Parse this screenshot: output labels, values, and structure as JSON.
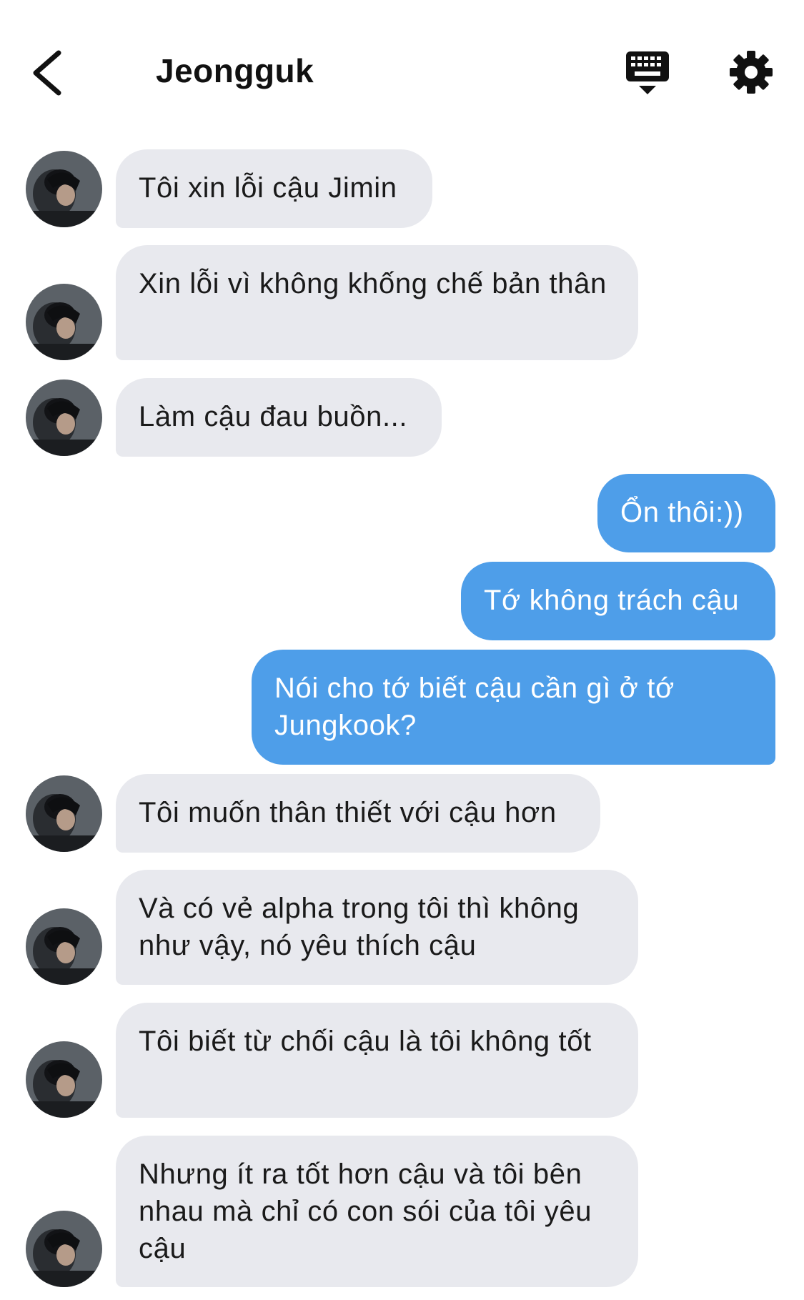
{
  "header": {
    "title": "Jeongguk",
    "icons": {
      "back": "chevron-left-icon",
      "keyboard": "keyboard-icon",
      "settings": "gear-icon"
    }
  },
  "colors": {
    "incoming_bubble": "#e8e9ee",
    "outgoing_bubble": "#4e9ee9",
    "outgoing_text": "#ffffff",
    "incoming_text": "#1a1a1a"
  },
  "messages": [
    {
      "sender": "Jeongguk",
      "direction": "incoming",
      "text": "Tôi xin lỗi cậu Jimin"
    },
    {
      "sender": "Jeongguk",
      "direction": "incoming",
      "text": "Xin lỗi vì không khống chế bản thân"
    },
    {
      "sender": "Jeongguk",
      "direction": "incoming",
      "text": "Làm cậu đau buồn..."
    },
    {
      "sender": "me",
      "direction": "outgoing",
      "text": "Ổn thôi:))"
    },
    {
      "sender": "me",
      "direction": "outgoing",
      "text": "Tớ không trách cậu"
    },
    {
      "sender": "me",
      "direction": "outgoing",
      "text": "Nói cho tớ biết cậu cần gì ở tớ Jungkook?"
    },
    {
      "sender": "Jeongguk",
      "direction": "incoming",
      "text": "Tôi muốn thân thiết với cậu hơn"
    },
    {
      "sender": "Jeongguk",
      "direction": "incoming",
      "text": "Và có vẻ alpha trong tôi thì không như vậy, nó yêu thích cậu"
    },
    {
      "sender": "Jeongguk",
      "direction": "incoming",
      "text": "Tôi biết từ chối cậu là tôi không tốt"
    },
    {
      "sender": "Jeongguk",
      "direction": "incoming",
      "text": "Nhưng ít ra tốt hơn cậu và tôi bên nhau mà chỉ có con sói của tôi yêu cậu"
    }
  ]
}
